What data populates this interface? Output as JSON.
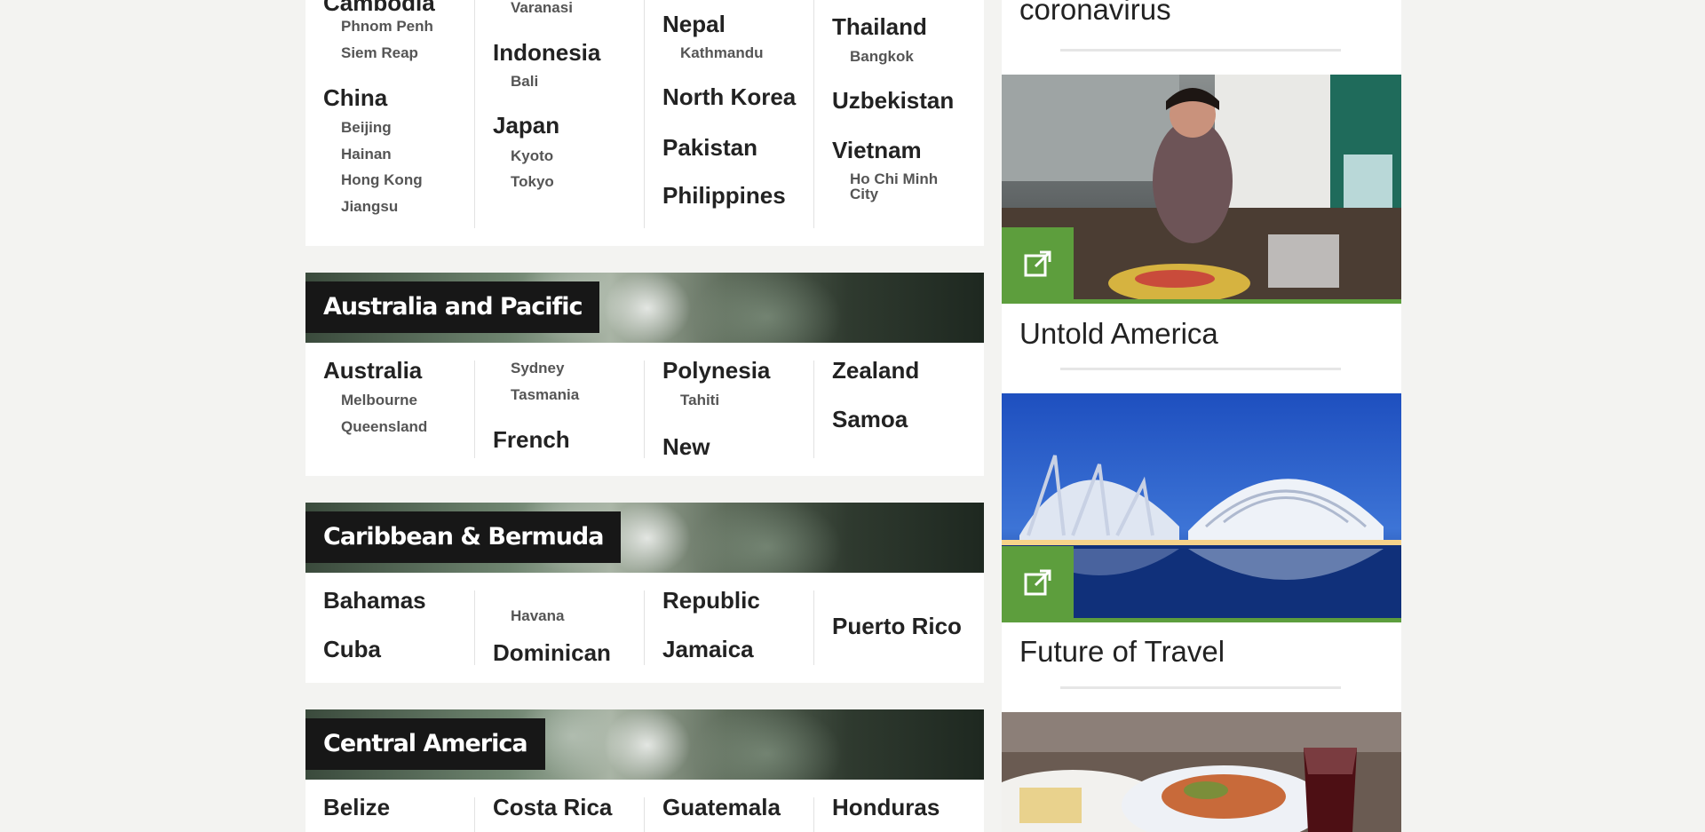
{
  "asia": {
    "col1": {
      "country_cut": "Cambodia",
      "cities_a": [
        "Phnom Penh",
        "Siem Reap"
      ],
      "country2": "China",
      "cities_b": [
        "Beijing",
        "Hainan",
        "Hong Kong",
        "Jiangsu"
      ]
    },
    "col2": {
      "city_top": "Varanasi",
      "country1": "Indonesia",
      "cities_a": [
        "Bali"
      ],
      "country2": "Japan",
      "cities_b": [
        "Kyoto",
        "Tokyo"
      ]
    },
    "col3": {
      "country1": "Nepal",
      "cities_a": [
        "Kathmandu"
      ],
      "country2": "North Korea",
      "country3": "Pakistan",
      "country4": "Philippines"
    },
    "col4": {
      "country1": "Thailand",
      "cities_a": [
        "Bangkok"
      ],
      "country2": "Uzbekistan",
      "country3": "Vietnam",
      "city_multi_1": "Ho Chi Minh",
      "city_multi_2": "City"
    }
  },
  "australia": {
    "title": "Australia and Pacific",
    "col1": {
      "country": "Australia",
      "cities": [
        "Melbourne",
        "Queensland"
      ]
    },
    "col2": {
      "cities": [
        "Sydney",
        "Tasmania"
      ],
      "country": "French"
    },
    "col3": {
      "country": "Polynesia",
      "cities": [
        "Tahiti"
      ],
      "country2": "New"
    },
    "col4": {
      "country": "Zealand",
      "country2": "Samoa"
    }
  },
  "caribbean": {
    "title": "Caribbean & Bermuda",
    "col1": {
      "country": "Bahamas",
      "country2": "Cuba"
    },
    "col2": {
      "cities": [
        "Havana"
      ],
      "country": "Dominican"
    },
    "col3": {
      "country": "Republic",
      "country2": "Jamaica"
    },
    "col4": {
      "country": "Puerto Rico"
    }
  },
  "central": {
    "title": "Central America",
    "countries": [
      "Belize",
      "Costa Rica",
      "Guatemala",
      "Honduras"
    ]
  },
  "sidebar": {
    "story0_title": "coronavirus",
    "story0_title_partial": "...",
    "story1_title": "Untold America",
    "story2_title": "Future of Travel",
    "accent": "#5d9e3d",
    "icons": [
      "external-link-icon"
    ]
  }
}
